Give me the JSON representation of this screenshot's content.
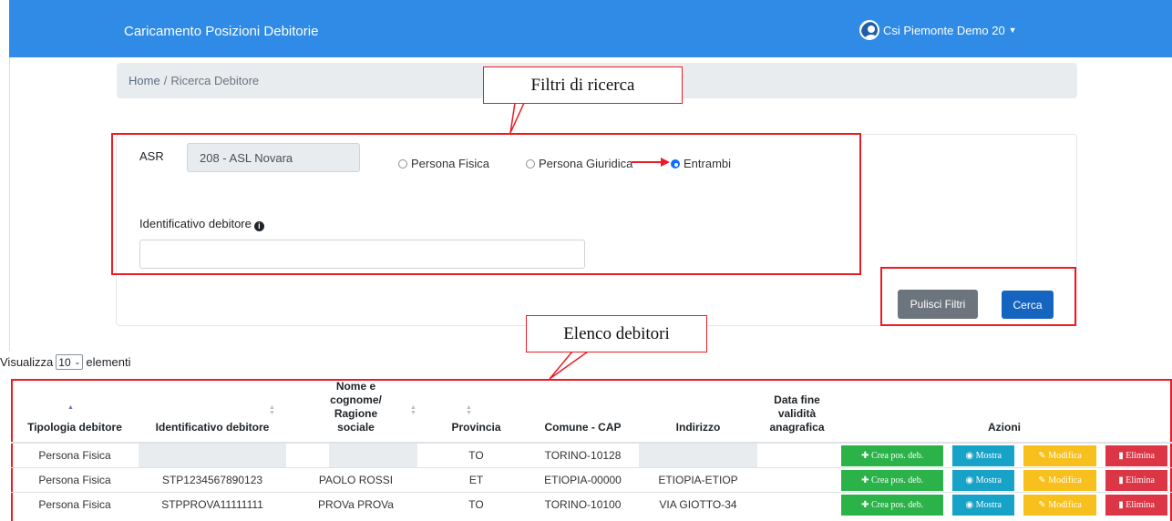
{
  "header": {
    "title": "Caricamento Posizioni Debitorie",
    "user": "Csi Piemonte Demo 20"
  },
  "breadcrumb": {
    "home": "Home",
    "separator": "/",
    "current": "Ricerca Debitore"
  },
  "filters": {
    "asr_label": "ASR",
    "asr_value": "208 - ASL Novara",
    "radios": [
      {
        "label": "Persona Fisica",
        "checked": false
      },
      {
        "label": "Persona Giuridica",
        "checked": false
      },
      {
        "label": "Entrambi",
        "checked": true
      }
    ],
    "id_label": "Identificativo debitore",
    "id_value": "",
    "clear_button": "Pulisci Filtri",
    "search_button": "Cerca"
  },
  "annotations": {
    "filters": "Filtri di ricerca",
    "list": "Elenco debitori"
  },
  "length_control": {
    "prefix": "Visualizza",
    "value": "10",
    "suffix": "elementi"
  },
  "table": {
    "columns": [
      "Tipologia debitore",
      "Identificativo debitore",
      "Nome e cognome/ Ragione sociale",
      "Provincia",
      "Comune - CAP",
      "Indirizzo",
      "Data fine validità anagrafica",
      "Azioni"
    ],
    "actions": {
      "create": "Crea pos. deb.",
      "show": "Mostra",
      "edit": "Modifica",
      "delete": "Elimina"
    },
    "rows": [
      {
        "tipo": "Persona Fisica",
        "id": "",
        "nome": "",
        "prov": "TO",
        "comune": "TORINO-10128",
        "indirizzo": "",
        "data": ""
      },
      {
        "tipo": "Persona Fisica",
        "id": "STP1234567890123",
        "nome": "PAOLO ROSSI",
        "prov": "ET",
        "comune": "ETIOPIA-00000",
        "indirizzo": "ETIOPIA-ETIOP",
        "data": ""
      },
      {
        "tipo": "Persona Fisica",
        "id": "STPPROVA11111111",
        "nome": "PROVa PROVa",
        "prov": "TO",
        "comune": "TORINO-10100",
        "indirizzo": "VIA GIOTTO-34",
        "data": ""
      }
    ]
  },
  "colors": {
    "navbar": "#2f8be6",
    "annotation_red": "#ed1c24",
    "btn_create": "#2bb34a",
    "btn_show": "#17a2c8",
    "btn_edit": "#f7c01d",
    "btn_delete": "#dc3545"
  },
  "icons": {
    "user": "user-avatar-icon",
    "info": "info-circle-icon",
    "create": "plus-icon",
    "show": "eye-icon",
    "edit": "edit-icon",
    "delete": "trash-icon"
  }
}
